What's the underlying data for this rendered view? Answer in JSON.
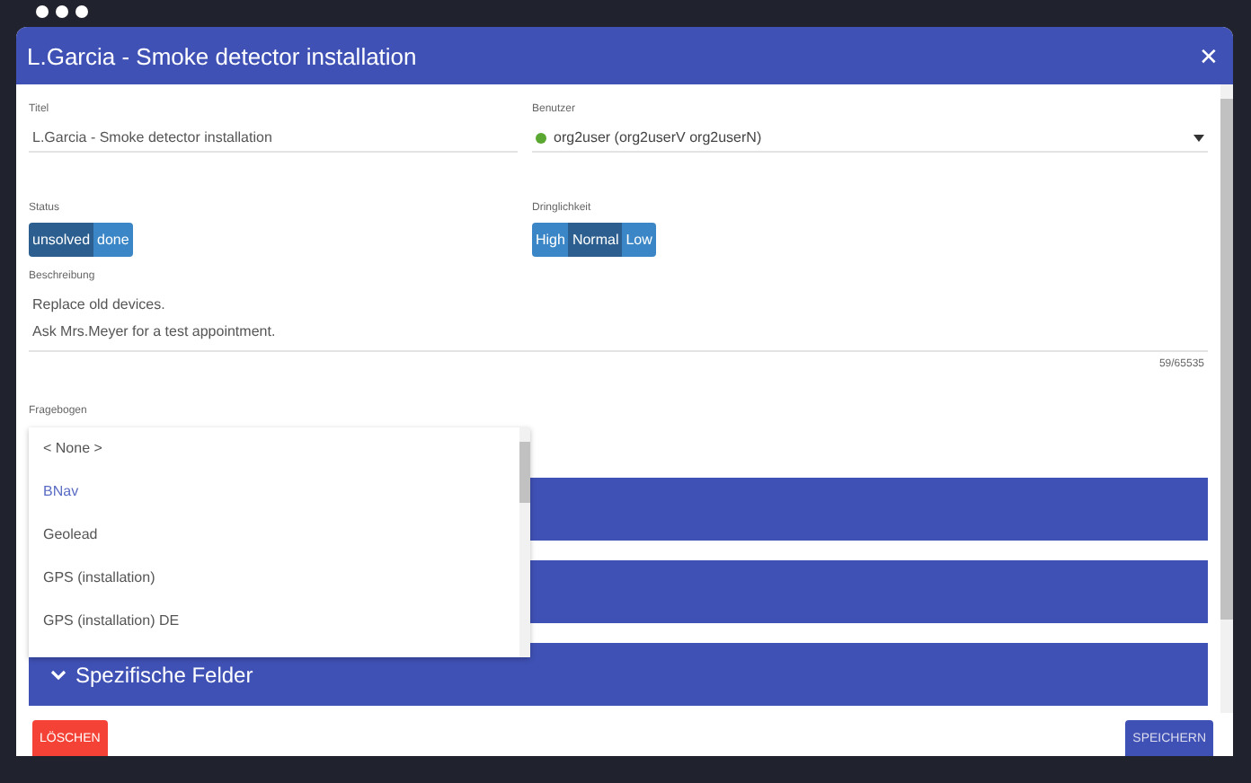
{
  "window": {
    "title": "L.Garcia - Smoke detector installation",
    "close": "✕"
  },
  "title_field": {
    "label": "Titel",
    "value": "L.Garcia - Smoke detector installation"
  },
  "user_field": {
    "label": "Benutzer",
    "value": "org2user (org2userV org2userN)",
    "color": "#5aa832"
  },
  "status": {
    "label": "Status",
    "options": [
      {
        "label": "unsolved",
        "selected": true
      },
      {
        "label": "done",
        "selected": false
      }
    ]
  },
  "urgency": {
    "label": "Dringlichkeit",
    "options": [
      {
        "label": "High",
        "selected": false
      },
      {
        "label": "Normal",
        "selected": true
      },
      {
        "label": "Low",
        "selected": false
      }
    ]
  },
  "description": {
    "label": "Beschreibung",
    "lines": [
      "Replace old devices.",
      "Ask Mrs.Meyer for a test appointment."
    ],
    "counter": "59/65535"
  },
  "questionnaire": {
    "label": "Fragebogen",
    "options": [
      {
        "label": "< None >",
        "selected": false
      },
      {
        "label": "BNav",
        "selected": true
      },
      {
        "label": "Geolead",
        "selected": false
      },
      {
        "label": "GPS (installation)",
        "selected": false
      },
      {
        "label": "GPS (installation) DE",
        "selected": false
      }
    ]
  },
  "sections": [
    {
      "kind": "panel"
    },
    {
      "kind": "panel"
    },
    {
      "kind": "panel",
      "title": "Spezifische Felder"
    }
  ],
  "buttons": {
    "delete": "LÖSCHEN",
    "save": "SPEICHERN"
  }
}
